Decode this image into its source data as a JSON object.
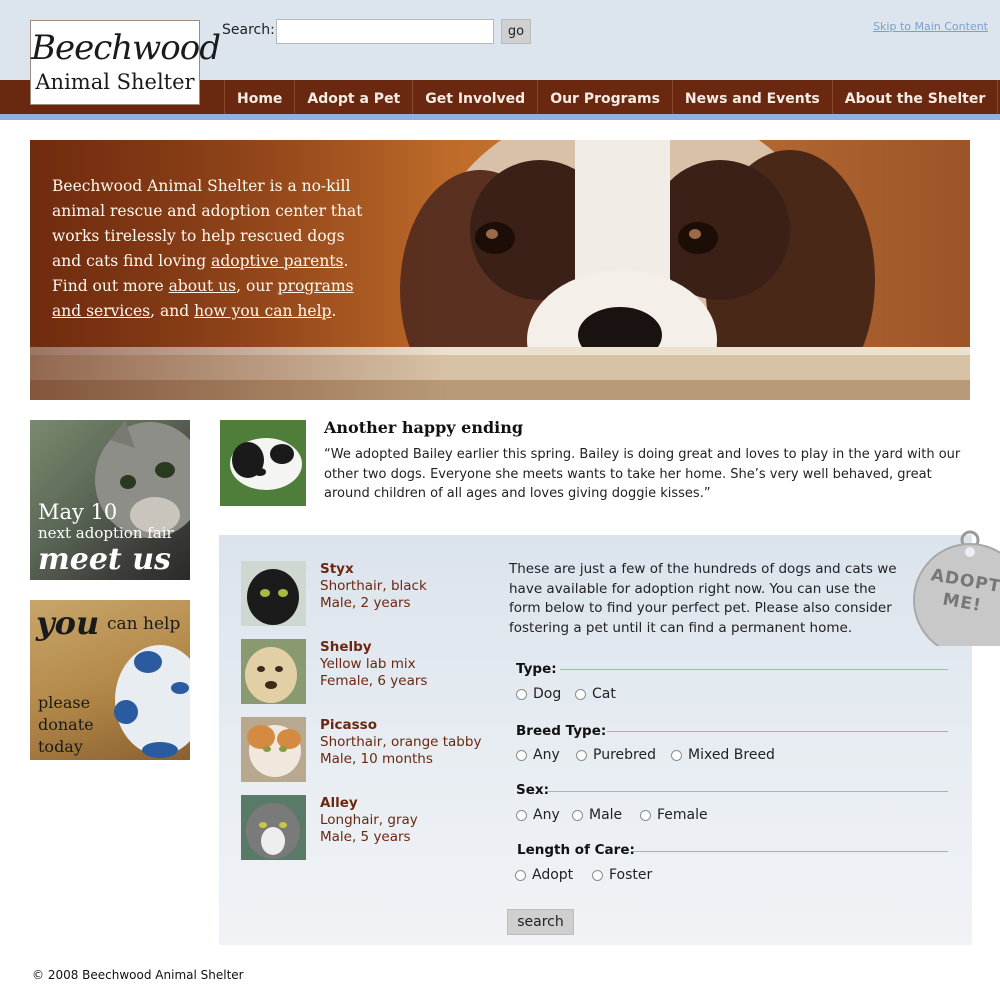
{
  "header": {
    "logo_line1": "Beechwood",
    "logo_line2": "Animal Shelter",
    "search_label": "Search:",
    "search_value": "",
    "go_label": "go",
    "skip_link": "Skip to Main Content"
  },
  "nav": {
    "items": [
      "Home",
      "Adopt a Pet",
      "Get Involved",
      "Our Programs",
      "News and Events",
      "About the Shelter"
    ]
  },
  "hero": {
    "t1": "Beechwood Animal Shelter is a no-kill animal rescue and adoption center that works tirelessly to help rescued dogs and cats find loving ",
    "link_parents": "adoptive parents",
    "t2": ". Find out more ",
    "link_about": "about us",
    "t3": ", our ",
    "link_programs": "programs and services",
    "t4": ", and ",
    "link_help": "how you can help",
    "t5": "."
  },
  "promos": {
    "fair_date": "May 10",
    "fair_text": "next adoption fair",
    "fair_cta": "meet us",
    "help_you": "you",
    "help_can": "can help",
    "help_line1": "please",
    "help_line2": "donate",
    "help_line3": "today"
  },
  "testimonial": {
    "title": "Another happy ending",
    "body": "“We adopted Bailey earlier this spring. Bailey is doing great and loves to play in the yard with our other two dogs. Everyone she meets wants to take her home. She’s very well behaved, great around children of all ages and loves giving doggie kisses.”"
  },
  "pets": [
    {
      "name": "Styx",
      "breed": "Shorthair, black",
      "age": "Male, 2 years"
    },
    {
      "name": "Shelby",
      "breed": "Yellow lab mix",
      "age": "Female, 6 years"
    },
    {
      "name": "Picasso",
      "breed": "Shorthair, orange tabby",
      "age": "Male, 10 months"
    },
    {
      "name": "Alley",
      "breed": "Longhair, gray",
      "age": "Male, 5 years"
    }
  ],
  "intro": "These are just a few of the hundreds of dogs and cats we have available for adoption right now. You can use the form below to find your perfect pet. Please also consider fostering a pet until it can find a permanent home.",
  "tag_text": "ADOPT ME!",
  "form": {
    "type": {
      "legend": "Type:",
      "options": [
        "Dog",
        "Cat"
      ]
    },
    "breed": {
      "legend": "Breed Type:",
      "options": [
        "Any",
        "Purebred",
        "Mixed Breed"
      ]
    },
    "sex": {
      "legend": "Sex:",
      "options": [
        "Any",
        "Male",
        "Female"
      ]
    },
    "care": {
      "legend": "Length of Care:",
      "options": [
        "Adopt",
        "Foster"
      ]
    },
    "submit": "search"
  },
  "footer": "© 2008 Beechwood Animal Shelter",
  "colors": {
    "nav_bg": "#6b2810",
    "accent_stripe": "#8fb1de",
    "pet_text": "#6b2810",
    "panel_bg": "#dbe3ec"
  }
}
